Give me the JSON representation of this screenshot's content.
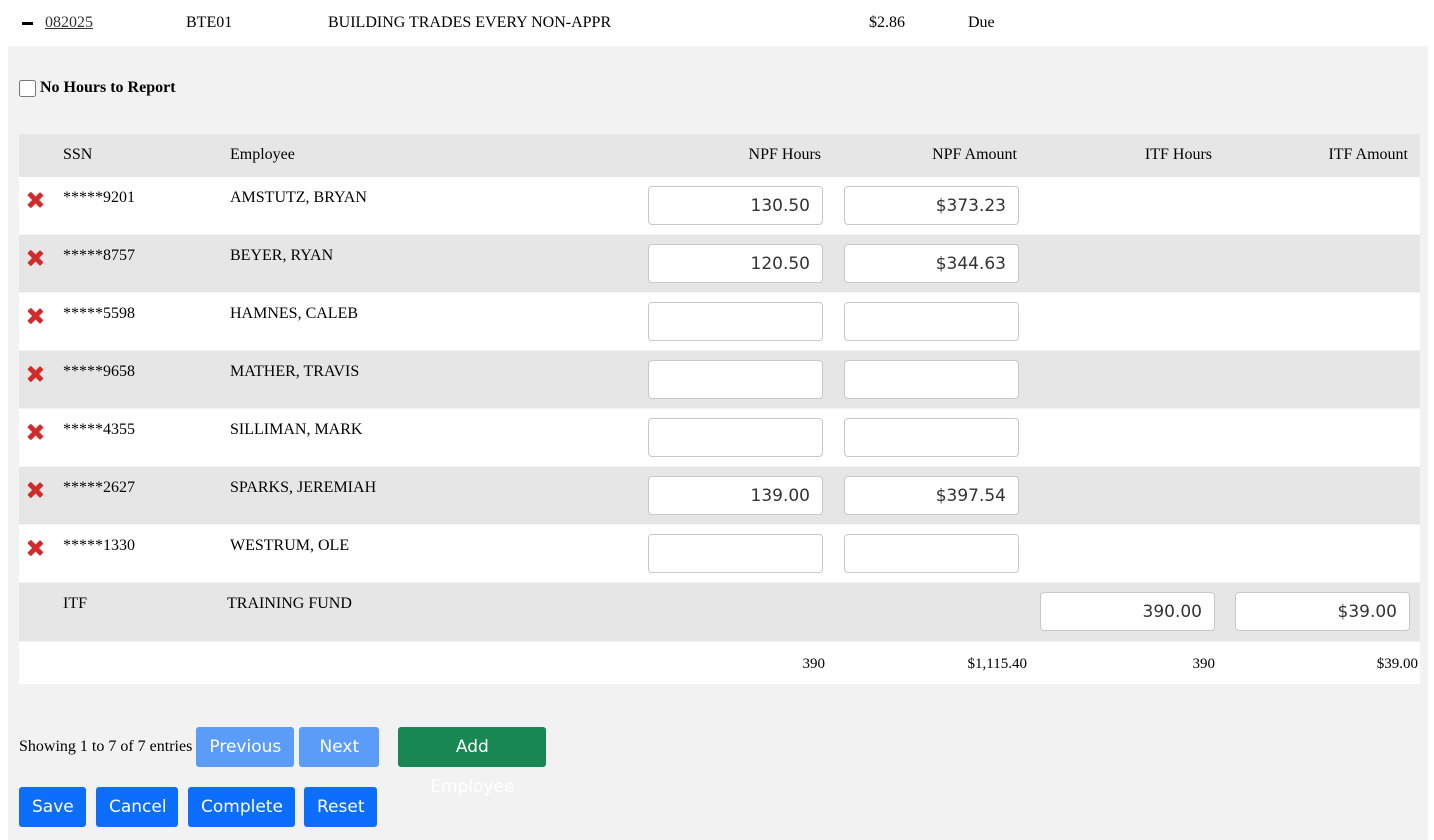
{
  "header_row": {
    "code": "082025",
    "fund": "BTE01",
    "description": "BUILDING TRADES EVERY NON-APPR",
    "rate": "$2.86",
    "status": "Due"
  },
  "no_hours_label": "No Hours to Report",
  "columns": {
    "ssn": "SSN",
    "employee": "Employee",
    "npf_hours": "NPF Hours",
    "npf_amount": "NPF Amount",
    "itf_hours": "ITF Hours",
    "itf_amount": "ITF Amount"
  },
  "employees": [
    {
      "ssn": "*****9201",
      "name": "AMSTUTZ, BRYAN",
      "npf_hours": "130.50",
      "npf_amount": "$373.23"
    },
    {
      "ssn": "*****8757",
      "name": "BEYER, RYAN",
      "npf_hours": "120.50",
      "npf_amount": "$344.63"
    },
    {
      "ssn": "*****5598",
      "name": "HAMNES, CALEB",
      "npf_hours": "",
      "npf_amount": ""
    },
    {
      "ssn": "*****9658",
      "name": "MATHER, TRAVIS",
      "npf_hours": "",
      "npf_amount": ""
    },
    {
      "ssn": "*****4355",
      "name": "SILLIMAN, MARK",
      "npf_hours": "",
      "npf_amount": ""
    },
    {
      "ssn": "*****2627",
      "name": "SPARKS, JEREMIAH",
      "npf_hours": "139.00",
      "npf_amount": "$397.54"
    },
    {
      "ssn": "*****1330",
      "name": "WESTRUM, OLE",
      "npf_hours": "",
      "npf_amount": ""
    }
  ],
  "fund_row": {
    "ssn": "ITF",
    "name": "TRAINING FUND",
    "itf_hours": "390.00",
    "itf_amount": "$39.00"
  },
  "totals": {
    "npf_hours": "390",
    "npf_amount": "$1,115.40",
    "itf_hours": "390",
    "itf_amount": "$39.00"
  },
  "paging": {
    "info": "Showing 1 to 7 of 7 entries",
    "previous": "Previous",
    "next": "Next",
    "add_employee": "Add Employee"
  },
  "actions": {
    "save": "Save",
    "cancel": "Cancel",
    "complete": "Complete",
    "reset": "Reset"
  },
  "colors": {
    "primary": "#0d6efd",
    "primary_disabled": "#5a9cf8",
    "success": "#198754",
    "delete": "#d12b2b"
  },
  "icons": {
    "collapse": "minus-icon",
    "delete": "close-icon"
  }
}
